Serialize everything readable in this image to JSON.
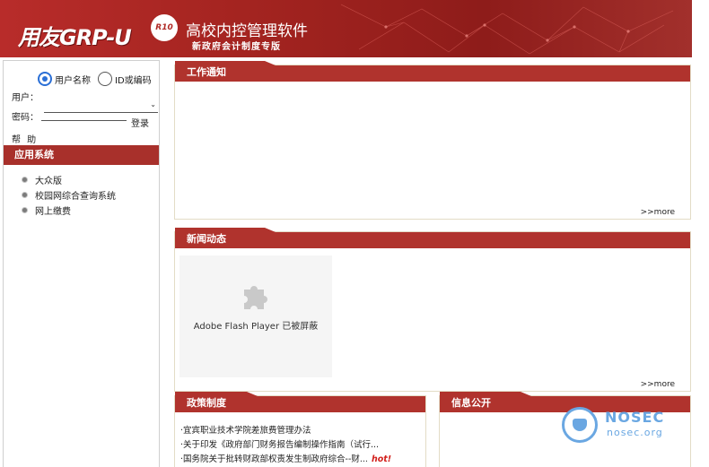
{
  "header": {
    "logo_text": "用友GRP-U",
    "logo_badge": "R10",
    "title": "高校内控管理软件",
    "subtitle": "新政府会计制度专版"
  },
  "login": {
    "radio_options": [
      {
        "label": "用户名称",
        "selected": true
      },
      {
        "label": "ID或编码",
        "selected": false
      }
    ],
    "user_label": "用户：",
    "password_label": "密码：",
    "login_button": "登录",
    "help_link": "帮 助"
  },
  "apps": {
    "heading": "应用系统",
    "items": [
      "大众版",
      "校园网综合查询系统",
      "网上缴费"
    ]
  },
  "panels": {
    "work_notice": {
      "title": "工作通知",
      "more": ">>more"
    },
    "news": {
      "title": "新闻动态",
      "more": ">>more",
      "flash_message": "Adobe Flash Player 已被屏蔽"
    },
    "policy": {
      "title": "政策制度",
      "items": [
        {
          "text": "·宜宾职业技术学院差旅费管理办法",
          "hot": ""
        },
        {
          "text": "·关于印发《政府部门财务报告编制操作指南（试行...",
          "hot": ""
        },
        {
          "text": "·国务院关于批转财政部权责发生制政府综合--财...",
          "hot": "hot!"
        }
      ]
    },
    "info": {
      "title": "信息公开"
    }
  },
  "watermark": {
    "brand": "NOSEC",
    "url": "nosec.org"
  },
  "colors": {
    "accent": "#b0332d",
    "banner": "#a42420",
    "watermark": "#6aa7e2"
  }
}
